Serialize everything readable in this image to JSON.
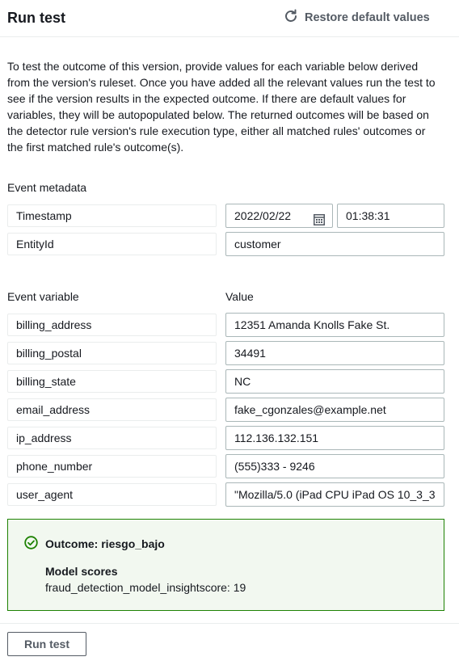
{
  "header": {
    "title": "Run test",
    "restore_label": "Restore default values"
  },
  "description": "To test the outcome of this version, provide values for each variable below derived from the version's ruleset. Once you have added all the relevant values run the test to see if the version results in the expected outcome. If there are default values for variables, they will be autopopulated below. The returned outcomes will be based on the detector rule version's rule execution type, either all matched rules' outcomes or the first matched rule's outcome(s).",
  "metadata": {
    "section_label": "Event metadata",
    "timestamp_label": "Timestamp",
    "date_value": "2022/02/22",
    "time_value": "01:38:31",
    "entity_label": "EntityId",
    "entity_value": "customer"
  },
  "variables": {
    "col_name": "Event variable",
    "col_value": "Value",
    "rows": [
      {
        "name": "billing_address",
        "value": "12351 Amanda Knolls Fake St."
      },
      {
        "name": "billing_postal",
        "value": "34491"
      },
      {
        "name": "billing_state",
        "value": "NC"
      },
      {
        "name": "email_address",
        "value": "fake_cgonzales@example.net"
      },
      {
        "name": "ip_address",
        "value": "112.136.132.151"
      },
      {
        "name": "phone_number",
        "value": "(555)333 - 9246"
      },
      {
        "name": "user_agent",
        "value": "\"Mozilla/5.0 (iPad CPU iPad OS 10_3_3"
      }
    ]
  },
  "outcome": {
    "title": "Outcome: riesgo_bajo",
    "scores_heading": "Model scores",
    "score_line": "fraud_detection_model_insightscore: 19",
    "color": "#1d8102"
  },
  "footer": {
    "run_button": "Run test"
  }
}
